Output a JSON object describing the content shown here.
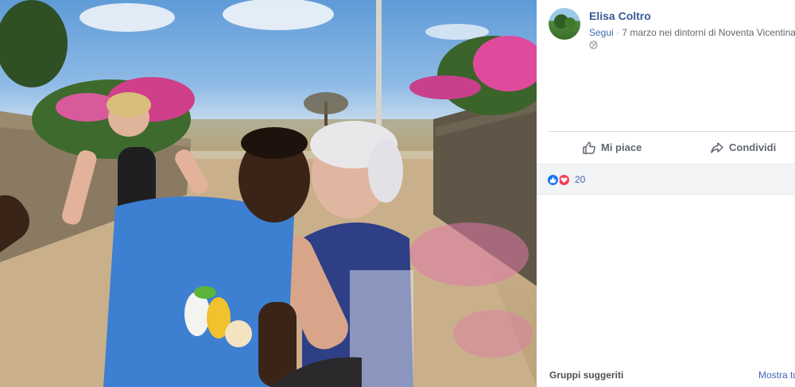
{
  "post": {
    "author": "Elisa Coltro",
    "follow_label": "Segui",
    "separator": " · ",
    "meta": "7 marzo nei dintorni di Noventa Vicentina"
  },
  "actions": {
    "like_label": "Mi piace",
    "share_label": "Condividi"
  },
  "reactions": {
    "count": "20",
    "icons": [
      "like-icon",
      "love-icon"
    ]
  },
  "sidebar": {
    "suggested_title": "Gruppi suggeriti",
    "show_all": "Mostra tu"
  },
  "colors": {
    "link_blue": "#385898",
    "like_blue": "#1877f2",
    "love_red": "#f33e58",
    "reaction_bar_bg": "#f2f3f5"
  }
}
